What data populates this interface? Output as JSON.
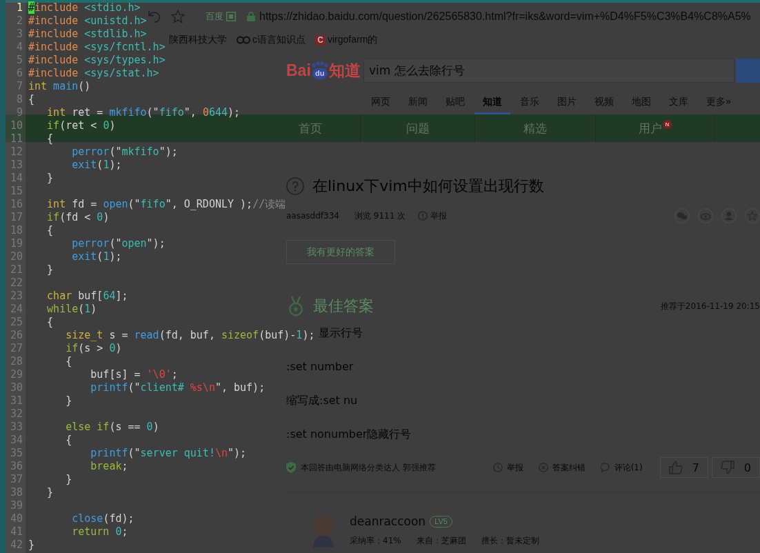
{
  "browser": {
    "toolbar": {
      "engine": "百度",
      "url": "https://zhidao.baidu.com/question/262565830.html?fr=iks&word=vim+%D4%F5%C3%B4%C8%A5%"
    },
    "bookmarks": [
      {
        "kind": "plain",
        "label": "陕西科技大学"
      },
      {
        "kind": "rings",
        "label": "c语言知识点"
      },
      {
        "kind": "letter",
        "letter": "C",
        "label": "virgofarm的"
      }
    ],
    "logo": {
      "left": "Bai",
      "pad": "du",
      "right": "知道"
    },
    "search": {
      "value": "vim 怎么去除行号"
    },
    "nav": [
      {
        "label": "网页",
        "selected": false
      },
      {
        "label": "新闻",
        "selected": false
      },
      {
        "label": "贴吧",
        "selected": false
      },
      {
        "label": "知道",
        "selected": true
      },
      {
        "label": "音乐",
        "selected": false
      },
      {
        "label": "图片",
        "selected": false
      },
      {
        "label": "视频",
        "selected": false
      },
      {
        "label": "地图",
        "selected": false
      },
      {
        "label": "文库",
        "selected": false
      },
      {
        "label": "更多»",
        "selected": false
      }
    ],
    "menu": [
      {
        "label": "首页"
      },
      {
        "label": "问题"
      },
      {
        "label": "精选"
      },
      {
        "label": "用户",
        "badge": "N"
      }
    ],
    "question": {
      "title": "在linux下vim中如何设置出现行数",
      "author": "aasasddf334",
      "views": "浏览 9111 次",
      "report": "举报"
    },
    "answer_button": "我有更好的答案",
    "best_answer": {
      "heading": "最佳答案",
      "date": "推荐于2016-11-19 20:15",
      "lines": [
        "显示行号",
        ":set number",
        "缩写成:set nu",
        ":set nonumber隐藏行号"
      ],
      "recommendation": "本回答由电脑网络分类达人 郭强推荐",
      "actions": [
        {
          "kind": "clock",
          "label": "举报"
        },
        {
          "kind": "cross",
          "label": "答案纠错"
        },
        {
          "kind": "bubble",
          "label": "评论(1)"
        }
      ],
      "votes": [
        {
          "kind": "up",
          "count": "7"
        },
        {
          "kind": "down",
          "count": "0"
        }
      ]
    },
    "other_answer": {
      "user": "deanraccoon",
      "level": "LV5",
      "stats": [
        "采纳率：41%",
        "来自：芝麻团",
        "擅长：暂未定制"
      ]
    }
  },
  "editor": {
    "lines": [
      {
        "number": "1",
        "current": true,
        "tokens": [
          {
            "kind": "cursor",
            "text": "#"
          },
          {
            "kind": "pre",
            "text": "include"
          },
          {
            "kind": "hdr",
            "text": " <stdio.h>"
          }
        ]
      },
      {
        "number": "2",
        "current": false,
        "tokens": [
          {
            "kind": "pre",
            "text": "#include"
          },
          {
            "kind": "hdr",
            "text": " <unistd.h>"
          }
        ]
      },
      {
        "number": "3",
        "current": false,
        "tokens": [
          {
            "kind": "pre",
            "text": "#include"
          },
          {
            "kind": "hdr",
            "text": " <stdlib.h>"
          }
        ]
      },
      {
        "number": "4",
        "current": false,
        "tokens": [
          {
            "kind": "pre",
            "text": "#include"
          },
          {
            "kind": "hdr",
            "text": " <sys/fcntl.h>"
          }
        ]
      },
      {
        "number": "5",
        "current": false,
        "tokens": [
          {
            "kind": "pre",
            "text": "#include"
          },
          {
            "kind": "hdr",
            "text": " <sys/types.h>"
          }
        ]
      },
      {
        "number": "6",
        "current": false,
        "tokens": [
          {
            "kind": "pre",
            "text": "#include"
          },
          {
            "kind": "hdr",
            "text": " <sys/stat.h>"
          }
        ]
      },
      {
        "number": "7",
        "current": false,
        "tokens": [
          {
            "kind": "type",
            "text": "int"
          },
          {
            "kind": "fn",
            "text": " main"
          },
          {
            "kind": "txt",
            "text": "()"
          }
        ]
      },
      {
        "number": "8",
        "current": false,
        "tokens": [
          {
            "kind": "txt",
            "text": "{"
          }
        ]
      },
      {
        "number": "9",
        "current": false,
        "tokens": [
          {
            "kind": "type",
            "text": "   int"
          },
          {
            "kind": "txt",
            "text": " ret = "
          },
          {
            "kind": "fn",
            "text": "mkfifo"
          },
          {
            "kind": "txt",
            "text": "(\""
          },
          {
            "kind": "str",
            "text": "fifo"
          },
          {
            "kind": "txt",
            "text": "\", "
          },
          {
            "kind": "oct",
            "text": "0"
          },
          {
            "kind": "num",
            "text": "644"
          },
          {
            "kind": "txt",
            "text": ");"
          }
        ]
      },
      {
        "number": "10",
        "current": false,
        "tokens": [
          {
            "kind": "kw",
            "text": "   if"
          },
          {
            "kind": "txt",
            "text": "(ret < "
          },
          {
            "kind": "num",
            "text": "0"
          },
          {
            "kind": "txt",
            "text": ")"
          }
        ]
      },
      {
        "number": "11",
        "current": false,
        "tokens": [
          {
            "kind": "txt",
            "text": "   {"
          }
        ]
      },
      {
        "number": "12",
        "current": false,
        "tokens": [
          {
            "kind": "fn",
            "text": "       perror"
          },
          {
            "kind": "txt",
            "text": "(\""
          },
          {
            "kind": "str",
            "text": "mkfifo"
          },
          {
            "kind": "txt",
            "text": "\");"
          }
        ]
      },
      {
        "number": "13",
        "current": false,
        "tokens": [
          {
            "kind": "fn",
            "text": "       exit"
          },
          {
            "kind": "txt",
            "text": "("
          },
          {
            "kind": "num",
            "text": "1"
          },
          {
            "kind": "txt",
            "text": ");"
          }
        ]
      },
      {
        "number": "14",
        "current": false,
        "tokens": [
          {
            "kind": "txt",
            "text": "   }"
          }
        ]
      },
      {
        "number": "15",
        "current": false
      },
      {
        "number": "16",
        "current": false,
        "tokens": [
          {
            "kind": "type",
            "text": "   int"
          },
          {
            "kind": "txt",
            "text": " fd = "
          },
          {
            "kind": "fn",
            "text": "open"
          },
          {
            "kind": "txt",
            "text": "(\""
          },
          {
            "kind": "str",
            "text": "fifo"
          },
          {
            "kind": "txt",
            "text": "\", O_RDONLY );"
          },
          {
            "kind": "cmt",
            "text": "//读端"
          }
        ]
      },
      {
        "number": "17",
        "current": false,
        "tokens": [
          {
            "kind": "kw",
            "text": "   if"
          },
          {
            "kind": "txt",
            "text": "(fd < "
          },
          {
            "kind": "num",
            "text": "0"
          },
          {
            "kind": "txt",
            "text": ")"
          }
        ]
      },
      {
        "number": "18",
        "current": false,
        "tokens": [
          {
            "kind": "txt",
            "text": "   {"
          }
        ]
      },
      {
        "number": "19",
        "current": false,
        "tokens": [
          {
            "kind": "fn",
            "text": "       perror"
          },
          {
            "kind": "txt",
            "text": "(\""
          },
          {
            "kind": "str",
            "text": "open"
          },
          {
            "kind": "txt",
            "text": "\");"
          }
        ]
      },
      {
        "number": "20",
        "current": false,
        "tokens": [
          {
            "kind": "fn",
            "text": "       exit"
          },
          {
            "kind": "txt",
            "text": "("
          },
          {
            "kind": "num",
            "text": "1"
          },
          {
            "kind": "txt",
            "text": ");"
          }
        ]
      },
      {
        "number": "21",
        "current": false,
        "tokens": [
          {
            "kind": "txt",
            "text": "   }"
          }
        ]
      },
      {
        "number": "22",
        "current": false
      },
      {
        "number": "23",
        "current": false,
        "tokens": [
          {
            "kind": "type",
            "text": "   char"
          },
          {
            "kind": "txt",
            "text": " buf["
          },
          {
            "kind": "num",
            "text": "64"
          },
          {
            "kind": "txt",
            "text": "];"
          }
        ]
      },
      {
        "number": "24",
        "current": false,
        "tokens": [
          {
            "kind": "kw",
            "text": "   while"
          },
          {
            "kind": "txt",
            "text": "("
          },
          {
            "kind": "num",
            "text": "1"
          },
          {
            "kind": "txt",
            "text": ")"
          }
        ]
      },
      {
        "number": "25",
        "current": false,
        "tokens": [
          {
            "kind": "txt",
            "text": "   {"
          }
        ]
      },
      {
        "number": "26",
        "current": false,
        "tokens": [
          {
            "kind": "type",
            "text": "      size_t"
          },
          {
            "kind": "txt",
            "text": " s = "
          },
          {
            "kind": "fn",
            "text": "read"
          },
          {
            "kind": "txt",
            "text": "(fd, buf, "
          },
          {
            "kind": "kw",
            "text": "sizeof"
          },
          {
            "kind": "txt",
            "text": "(buf)-"
          },
          {
            "kind": "num",
            "text": "1"
          },
          {
            "kind": "txt",
            "text": ");"
          }
        ]
      },
      {
        "number": "27",
        "current": false,
        "tokens": [
          {
            "kind": "kw",
            "text": "      if"
          },
          {
            "kind": "txt",
            "text": "(s > "
          },
          {
            "kind": "num",
            "text": "0"
          },
          {
            "kind": "txt",
            "text": ")"
          }
        ]
      },
      {
        "number": "28",
        "current": false,
        "tokens": [
          {
            "kind": "txt",
            "text": "      {"
          }
        ]
      },
      {
        "number": "29",
        "current": false,
        "tokens": [
          {
            "kind": "txt",
            "text": "          buf[s] = "
          },
          {
            "kind": "esc",
            "text": "'\\0'"
          },
          {
            "kind": "txt",
            "text": ";"
          }
        ]
      },
      {
        "number": "30",
        "current": false,
        "tokens": [
          {
            "kind": "fn",
            "text": "          printf"
          },
          {
            "kind": "txt",
            "text": "(\""
          },
          {
            "kind": "str",
            "text": "client# "
          },
          {
            "kind": "esc",
            "text": "%s\\n"
          },
          {
            "kind": "txt",
            "text": "\", buf);"
          }
        ]
      },
      {
        "number": "31",
        "current": false,
        "tokens": [
          {
            "kind": "txt",
            "text": "      }"
          }
        ]
      },
      {
        "number": "32",
        "current": false
      },
      {
        "number": "33",
        "current": false,
        "tokens": [
          {
            "kind": "kw",
            "text": "      else if"
          },
          {
            "kind": "txt",
            "text": "(s == "
          },
          {
            "kind": "num",
            "text": "0"
          },
          {
            "kind": "txt",
            "text": ")"
          }
        ]
      },
      {
        "number": "34",
        "current": false,
        "tokens": [
          {
            "kind": "txt",
            "text": "      {"
          }
        ]
      },
      {
        "number": "35",
        "current": false,
        "tokens": [
          {
            "kind": "fn",
            "text": "          printf"
          },
          {
            "kind": "txt",
            "text": "(\""
          },
          {
            "kind": "str",
            "text": "server quit!"
          },
          {
            "kind": "esc",
            "text": "\\n"
          },
          {
            "kind": "txt",
            "text": "\");"
          }
        ]
      },
      {
        "number": "36",
        "current": false,
        "tokens": [
          {
            "kind": "kw",
            "text": "          break"
          },
          {
            "kind": "txt",
            "text": ";"
          }
        ]
      },
      {
        "number": "37",
        "current": false,
        "tokens": [
          {
            "kind": "txt",
            "text": "      }"
          }
        ]
      },
      {
        "number": "38",
        "current": false,
        "tokens": [
          {
            "kind": "txt",
            "text": "   }"
          }
        ]
      },
      {
        "number": "39",
        "current": false
      },
      {
        "number": "40",
        "current": false,
        "tokens": [
          {
            "kind": "fn",
            "text": "       close"
          },
          {
            "kind": "txt",
            "text": "(fd);"
          }
        ]
      },
      {
        "number": "41",
        "current": false,
        "tokens": [
          {
            "kind": "kw",
            "text": "       return"
          },
          {
            "kind": "num",
            "text": " 0"
          },
          {
            "kind": "txt",
            "text": ";"
          }
        ]
      },
      {
        "number": "42",
        "current": false,
        "tokens": [
          {
            "kind": "txt",
            "text": "}"
          }
        ]
      }
    ]
  }
}
